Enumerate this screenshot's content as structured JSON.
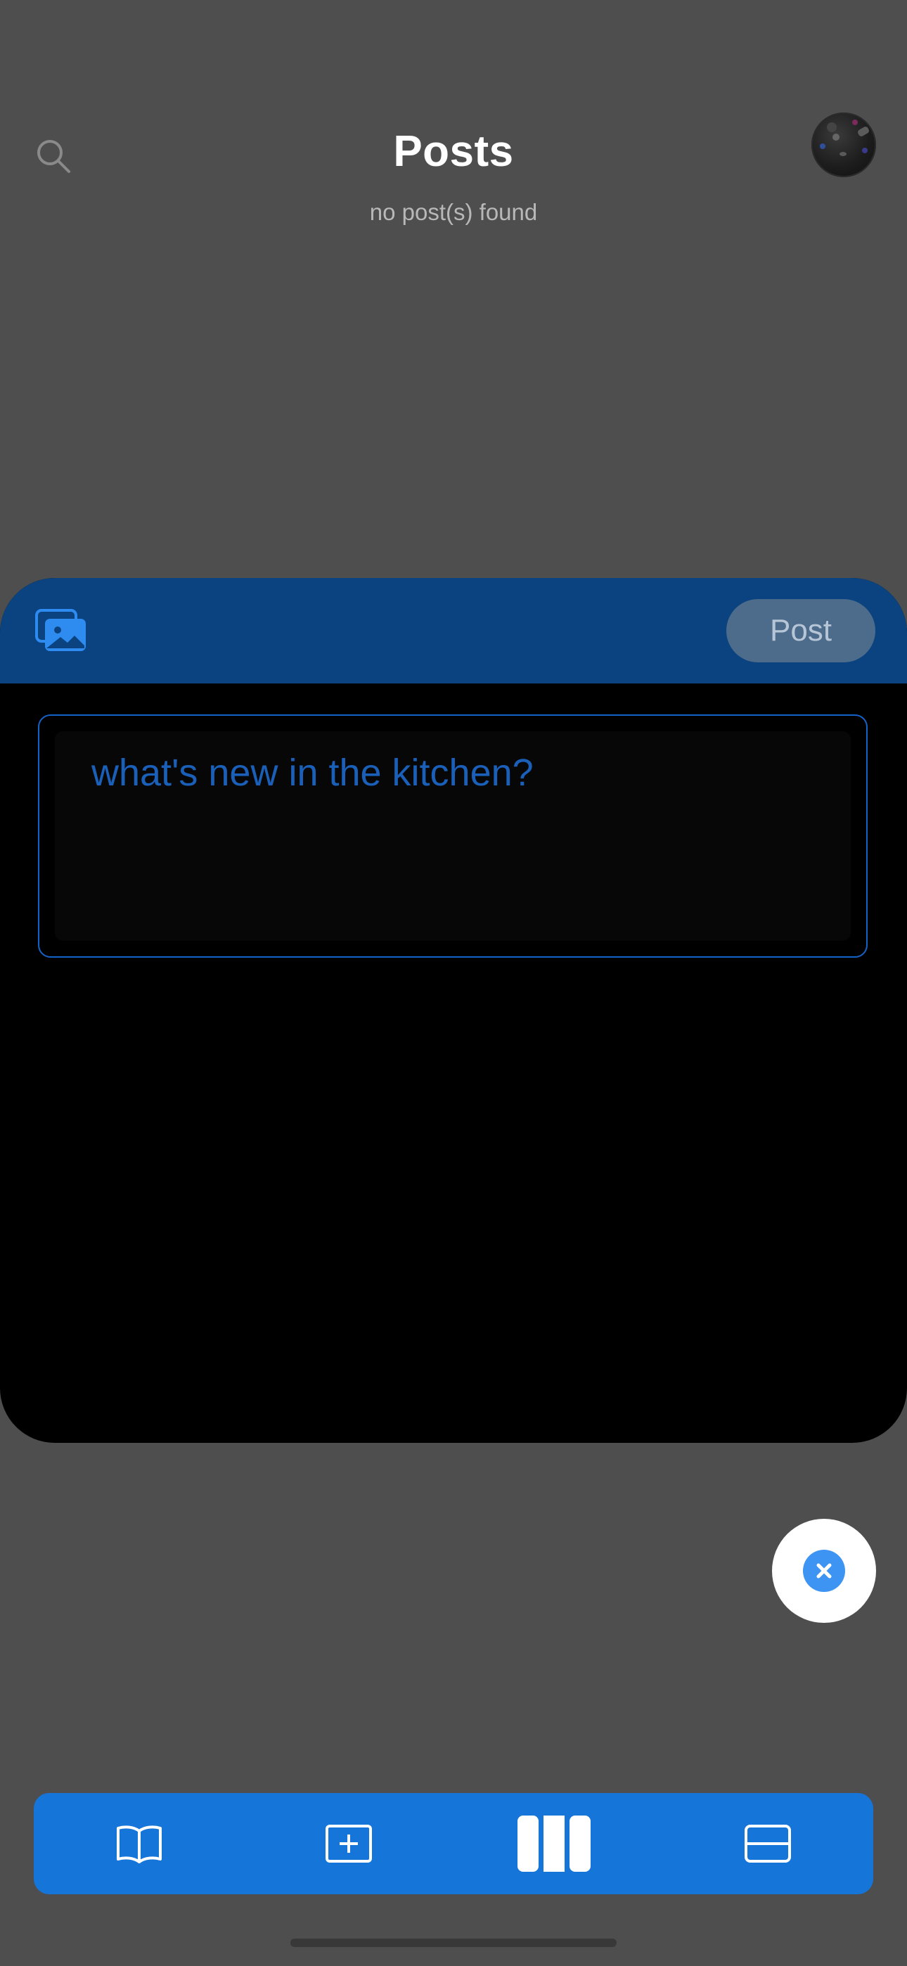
{
  "header": {
    "title": "Posts",
    "subtitle": "no post(s) found",
    "search_icon": "search-icon",
    "avatar": "user-avatar"
  },
  "composer": {
    "gallery_icon": "photo-gallery-icon",
    "post_label": "Post",
    "placeholder": "what's new in the kitchen?",
    "value": ""
  },
  "fab": {
    "icon": "close-icon"
  },
  "tabbar": {
    "items": [
      {
        "name": "book-icon",
        "selected": false
      },
      {
        "name": "add-square-icon",
        "selected": false
      },
      {
        "name": "columns-icon",
        "selected": true
      },
      {
        "name": "card-icon",
        "selected": false
      }
    ]
  },
  "colors": {
    "backdrop": "#4e4e4e",
    "sheet_header": "#0a437f",
    "accent": "#1675d9",
    "placeholder": "#1a5fb8",
    "post_button": "#4d6b8a",
    "fab_inner": "#3d94f2"
  }
}
